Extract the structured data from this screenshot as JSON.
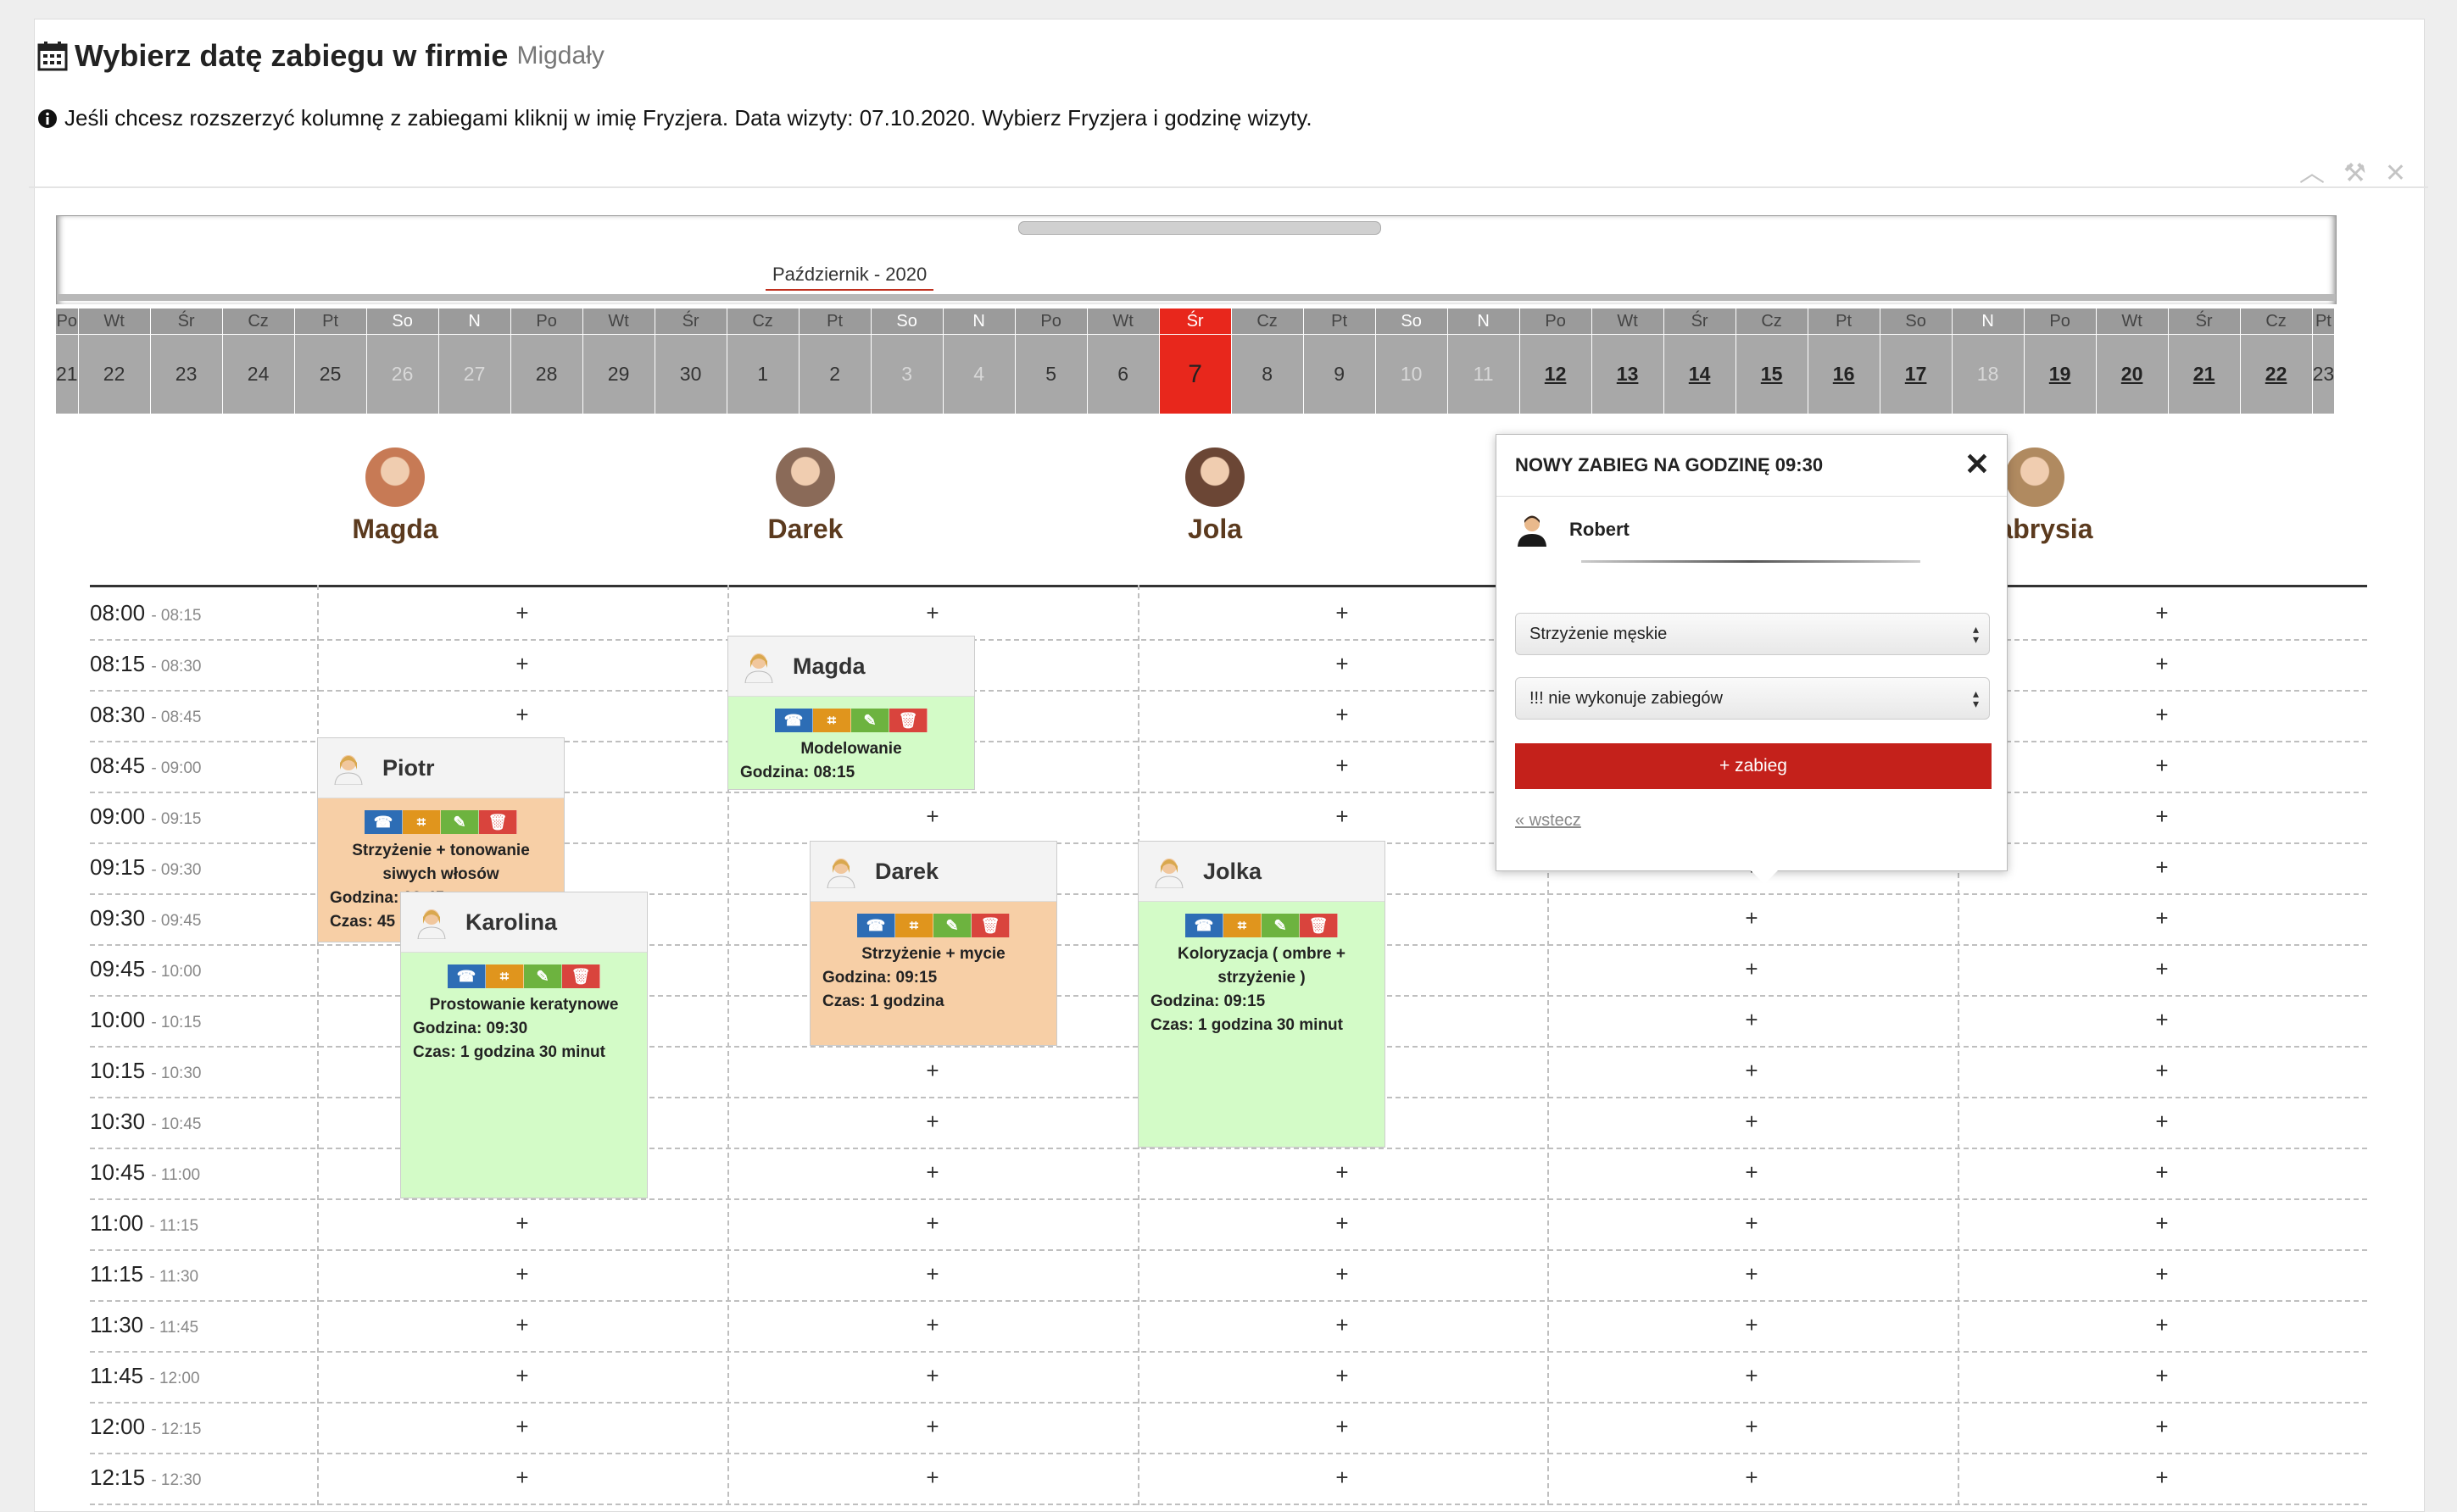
{
  "header": {
    "title": "Wybierz datę zabiegu w firmie",
    "company": "Migdały",
    "info": "Jeśli chcesz rozszerzyć kolumnę z zabiegami kliknij w imię Fryzjera. Data wizyty: 07.10.2020. Wybierz Fryzjera i godzinę wizyty."
  },
  "calendar": {
    "month_label": "Październik - 2020",
    "days": [
      {
        "n": "Po",
        "d": "21",
        "type": "partial"
      },
      {
        "n": "Wt",
        "d": "22",
        "type": "past"
      },
      {
        "n": "Śr",
        "d": "23",
        "type": "past"
      },
      {
        "n": "Cz",
        "d": "24",
        "type": "past"
      },
      {
        "n": "Pt",
        "d": "25",
        "type": "past"
      },
      {
        "n": "So",
        "d": "26",
        "type": "we"
      },
      {
        "n": "N",
        "d": "27",
        "type": "we"
      },
      {
        "n": "Po",
        "d": "28",
        "type": "past"
      },
      {
        "n": "Wt",
        "d": "29",
        "type": "past"
      },
      {
        "n": "Śr",
        "d": "30",
        "type": "past"
      },
      {
        "n": "Cz",
        "d": "1",
        "type": "past"
      },
      {
        "n": "Pt",
        "d": "2",
        "type": "past"
      },
      {
        "n": "So",
        "d": "3",
        "type": "we"
      },
      {
        "n": "N",
        "d": "4",
        "type": "we"
      },
      {
        "n": "Po",
        "d": "5",
        "type": "past"
      },
      {
        "n": "Wt",
        "d": "6",
        "type": "past"
      },
      {
        "n": "Śr",
        "d": "7",
        "type": "today"
      },
      {
        "n": "Cz",
        "d": "8",
        "type": "past"
      },
      {
        "n": "Pt",
        "d": "9",
        "type": "past"
      },
      {
        "n": "So",
        "d": "10",
        "type": "we"
      },
      {
        "n": "N",
        "d": "11",
        "type": "we"
      },
      {
        "n": "Po",
        "d": "12",
        "type": "future"
      },
      {
        "n": "Wt",
        "d": "13",
        "type": "future"
      },
      {
        "n": "Śr",
        "d": "14",
        "type": "future"
      },
      {
        "n": "Cz",
        "d": "15",
        "type": "future"
      },
      {
        "n": "Pt",
        "d": "16",
        "type": "future"
      },
      {
        "n": "So",
        "d": "17",
        "type": "future"
      },
      {
        "n": "N",
        "d": "18",
        "type": "we"
      },
      {
        "n": "Po",
        "d": "19",
        "type": "future"
      },
      {
        "n": "Wt",
        "d": "20",
        "type": "future"
      },
      {
        "n": "Śr",
        "d": "21",
        "type": "future"
      },
      {
        "n": "Cz",
        "d": "22",
        "type": "future"
      },
      {
        "n": "Pt",
        "d": "23",
        "type": "partial"
      }
    ]
  },
  "staff": [
    "Magda",
    "Darek",
    "Jola",
    "Robert",
    "Gabrysia"
  ],
  "timeslots": [
    {
      "start": "08:00",
      "end": "- 08:15"
    },
    {
      "start": "08:15",
      "end": "- 08:30"
    },
    {
      "start": "08:30",
      "end": "- 08:45"
    },
    {
      "start": "08:45",
      "end": "- 09:00"
    },
    {
      "start": "09:00",
      "end": "- 09:15"
    },
    {
      "start": "09:15",
      "end": "- 09:30"
    },
    {
      "start": "09:30",
      "end": "- 09:45"
    },
    {
      "start": "09:45",
      "end": "- 10:00"
    },
    {
      "start": "10:00",
      "end": "- 10:15"
    },
    {
      "start": "10:15",
      "end": "- 10:30"
    },
    {
      "start": "10:30",
      "end": "- 10:45"
    },
    {
      "start": "10:45",
      "end": "- 11:00"
    },
    {
      "start": "11:00",
      "end": "- 11:15"
    },
    {
      "start": "11:15",
      "end": "- 11:30"
    },
    {
      "start": "11:30",
      "end": "- 11:45"
    },
    {
      "start": "11:45",
      "end": "- 12:00"
    },
    {
      "start": "12:00",
      "end": "- 12:15"
    },
    {
      "start": "12:15",
      "end": "- 12:30"
    }
  ],
  "plus_symbol": "+",
  "appointments": [
    {
      "client": "Piotr",
      "service": "Strzyżenie + tonowanie siwych włosów",
      "time": "Godzina: 08:45",
      "duration": "Czas: 45 minut",
      "color": "orange"
    },
    {
      "client": "Karolina",
      "service": "Prostowanie keratynowe",
      "time": "Godzina: 09:30",
      "duration": "Czas: 1 godzina 30 minut",
      "color": "green"
    },
    {
      "client": "Magda",
      "service": "Modelowanie",
      "time": "Godzina: 08:15",
      "color": "green"
    },
    {
      "client": "Darek",
      "service": "Strzyżenie + mycie",
      "time": "Godzina: 09:15",
      "duration": "Czas: 1 godzina",
      "color": "orange"
    },
    {
      "client": "Jolka",
      "service": "Koloryzacja ( ombre + strzyżenie )",
      "time": "Godzina: 09:15",
      "duration": "Czas: 1 godzina 30 minut",
      "color": "green"
    }
  ],
  "popup": {
    "title": "NOWY ZABIEG NA GODZINĘ 09:30",
    "staff_name": "Robert",
    "service_select": "Strzyżenie męskie",
    "second_select": "!!! nie wykonuje zabiegów",
    "add_button": "+ zabieg",
    "back_link": "« wstecz"
  },
  "colors": {
    "today": "#e8271c",
    "staff_name": "#5b3a1e",
    "add_button": "#c4211b",
    "card_orange": "#f7cfa6",
    "card_green": "#d3fbc7"
  }
}
